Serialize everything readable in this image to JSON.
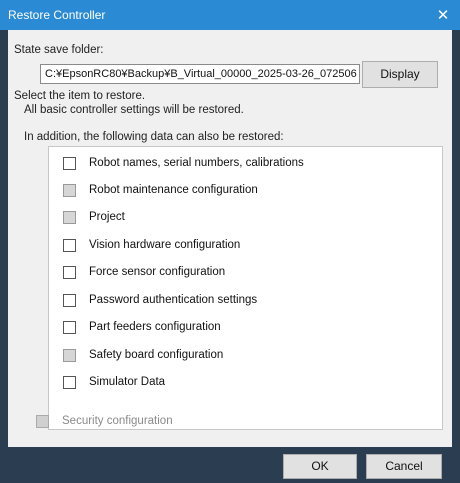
{
  "window": {
    "title": "Restore Controller",
    "close_glyph": "✕"
  },
  "folder": {
    "label": "State save folder:",
    "path": "C:¥EpsonRC80¥Backup¥B_Virtual_00000_2025-03-26_072506",
    "display_button": "Display"
  },
  "instructions": {
    "select": "Select the item to restore.",
    "basic": "All basic controller settings will be restored.",
    "addition": "In addition, the following data can also be restored:"
  },
  "items": [
    {
      "label": "Robot names, serial numbers, calibrations",
      "checked": false,
      "disabled": false
    },
    {
      "label": "Robot maintenance configuration",
      "checked": false,
      "disabled": true
    },
    {
      "label": "Project",
      "checked": false,
      "disabled": true
    },
    {
      "label": "Vision hardware configuration",
      "checked": false,
      "disabled": false
    },
    {
      "label": "Force sensor configuration",
      "checked": false,
      "disabled": false
    },
    {
      "label": "Password authentication settings",
      "checked": false,
      "disabled": false
    },
    {
      "label": "Part feeders configuration",
      "checked": false,
      "disabled": false
    },
    {
      "label": "Safety board configuration",
      "checked": false,
      "disabled": true
    },
    {
      "label": "Simulator Data",
      "checked": false,
      "disabled": false
    }
  ],
  "security": {
    "label": "Security configuration",
    "checked": false,
    "disabled": true
  },
  "buttons": {
    "ok": "OK",
    "cancel": "Cancel"
  }
}
